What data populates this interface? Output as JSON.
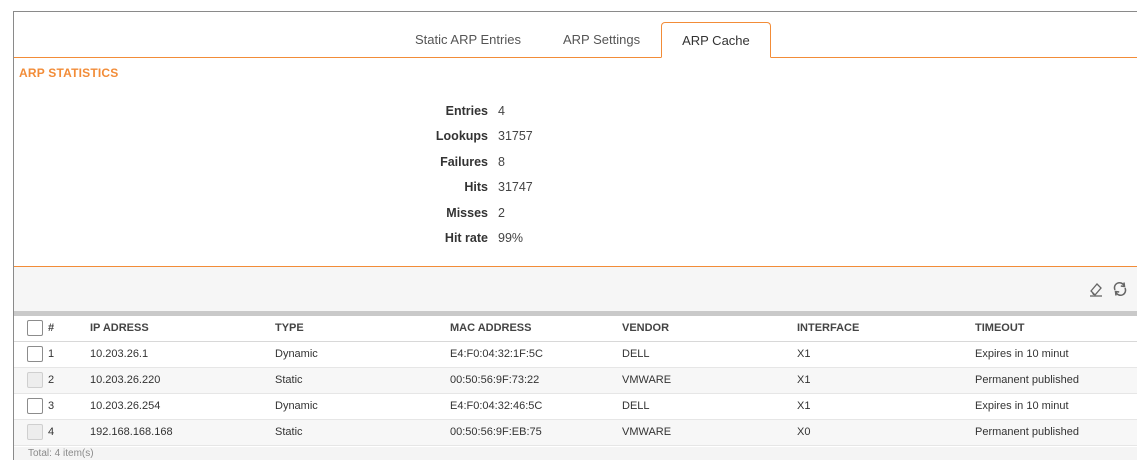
{
  "tabs": [
    {
      "label": "Static ARP Entries",
      "active": false
    },
    {
      "label": "ARP Settings",
      "active": false
    },
    {
      "label": "ARP Cache",
      "active": true
    }
  ],
  "section_title": "ARP STATISTICS",
  "stats": [
    {
      "label": "Entries",
      "value": "4"
    },
    {
      "label": "Lookups",
      "value": "31757"
    },
    {
      "label": "Failures",
      "value": "8"
    },
    {
      "label": "Hits",
      "value": "31747"
    },
    {
      "label": "Misses",
      "value": "2"
    },
    {
      "label": "Hit rate",
      "value": "99%"
    }
  ],
  "toolbar": {
    "icons": [
      "eraser-icon",
      "refresh-icon"
    ]
  },
  "table": {
    "columns": [
      "#",
      "IP ADRESS",
      "TYPE",
      "MAC ADDRESS",
      "VENDOR",
      "INTERFACE",
      "TIMEOUT"
    ],
    "rows": [
      {
        "num": "1",
        "ip": "10.203.26.1",
        "type": "Dynamic",
        "mac": "E4:F0:04:32:1F:5C",
        "vendor": "DELL",
        "interface": "X1",
        "timeout": "Expires in 10 minut",
        "checkbox_enabled": true
      },
      {
        "num": "2",
        "ip": "10.203.26.220",
        "type": "Static",
        "mac": "00:50:56:9F:73:22",
        "vendor": "VMWARE",
        "interface": "X1",
        "timeout": "Permanent published",
        "checkbox_enabled": false
      },
      {
        "num": "3",
        "ip": "10.203.26.254",
        "type": "Dynamic",
        "mac": "E4:F0:04:32:46:5C",
        "vendor": "DELL",
        "interface": "X1",
        "timeout": "Expires in 10 minut",
        "checkbox_enabled": true
      },
      {
        "num": "4",
        "ip": "192.168.168.168",
        "type": "Static",
        "mac": "00:50:56:9F:EB:75",
        "vendor": "VMWARE",
        "interface": "X0",
        "timeout": "Permanent published",
        "checkbox_enabled": false
      }
    ]
  },
  "footer": {
    "total_text": "Total: 4 item(s)"
  },
  "colors": {
    "accent": "#f28c38"
  }
}
